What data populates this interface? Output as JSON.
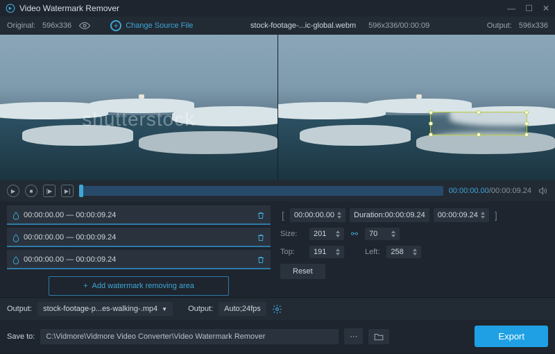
{
  "titlebar": {
    "title": "Video Watermark Remover"
  },
  "topbar": {
    "original_label": "Original:",
    "original_dims": "596x336",
    "change_source": "Change Source File",
    "filename": "stock-footage-...ic-global.webm",
    "source_info": "596x336/00:00:09",
    "output_label": "Output:",
    "output_dims": "596x336"
  },
  "watermark": {
    "text": "shutterstock"
  },
  "player": {
    "current": "00:00:00.00",
    "total": "00:00:09.24"
  },
  "areas": [
    {
      "start": "00:00:00.00",
      "sep": "—",
      "end": "00:00:09.24"
    },
    {
      "start": "00:00:00.00",
      "sep": "—",
      "end": "00:00:09.24"
    },
    {
      "start": "00:00:00.00",
      "sep": "—",
      "end": "00:00:09.24"
    }
  ],
  "add_area_label": "Add watermark removing area",
  "duration": {
    "start": "00:00:00.00",
    "dur_label": "Duration:",
    "dur_value": "00:00:09.24",
    "end": "00:00:09.24"
  },
  "size": {
    "label": "Size:",
    "w": "201",
    "h": "70"
  },
  "pos": {
    "top_label": "Top:",
    "top": "191",
    "left_label": "Left:",
    "left": "258"
  },
  "reset_label": "Reset",
  "output": {
    "label1": "Output:",
    "file": "stock-footage-p...es-walking-.mp4",
    "label2": "Output:",
    "fmt": "Auto;24fps"
  },
  "save": {
    "label": "Save to:",
    "path": "C:\\Vidmore\\Vidmore Video Converter\\Video Watermark Remover"
  },
  "export_label": "Export"
}
